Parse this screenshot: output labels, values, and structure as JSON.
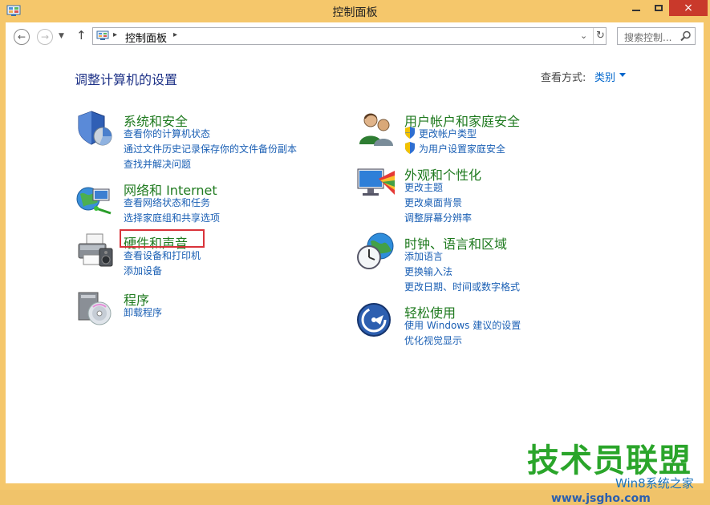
{
  "window": {
    "title": "控制面板",
    "close_glyph": "×"
  },
  "nav": {
    "address_path": "控制面板",
    "search_placeholder": "搜索控制...",
    "sep": "▸"
  },
  "header": {
    "title": "调整计算机的设置",
    "viewby_label": "查看方式:",
    "viewby_value": "类别"
  },
  "left": [
    {
      "head": "系统和安全",
      "links": [
        "查看你的计算机状态",
        "通过文件历史记录保存你的文件备份副本",
        "查找并解决问题"
      ]
    },
    {
      "head": "网络和 Internet",
      "links": [
        "查看网络状态和任务",
        "选择家庭组和共享选项"
      ]
    },
    {
      "head": "硬件和声音",
      "links": [
        "查看设备和打印机",
        "添加设备"
      ]
    },
    {
      "head": "程序",
      "links": [
        "卸载程序"
      ]
    }
  ],
  "right": [
    {
      "head": "用户帐户和家庭安全",
      "links": [
        "更改帐户类型",
        "为用户设置家庭安全"
      ]
    },
    {
      "head": "外观和个性化",
      "links": [
        "更改主题",
        "更改桌面背景",
        "调整屏幕分辨率"
      ]
    },
    {
      "head": "时钟、语言和区域",
      "links": [
        "添加语言",
        "更换输入法",
        "更改日期、时间或数字格式"
      ]
    },
    {
      "head": "轻松使用",
      "links": [
        "使用 Windows 建议的设置",
        "优化视觉显示"
      ]
    }
  ],
  "watermark": {
    "big": "技术员联盟",
    "small": "Win8系统之家",
    "url": "www.jsgho.com"
  },
  "colors": {
    "titlebar": "#f5c76b",
    "accent_link": "#1a5fb4",
    "category_head": "#1f7a1f",
    "highlight": "#d9333a"
  }
}
